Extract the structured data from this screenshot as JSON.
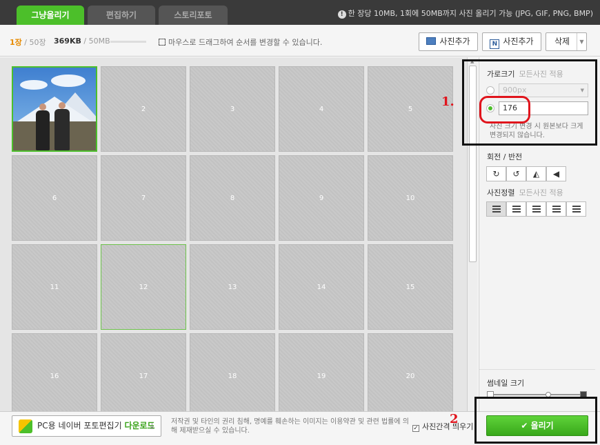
{
  "tabs": [
    {
      "label": "그냥올리기"
    },
    {
      "label": "편집하기"
    },
    {
      "label": "스토리포토"
    }
  ],
  "notice": "한 장당 10MB, 1회에 50MB까지 사진 올리기 가능 (JPG, GIF, PNG, BMP)",
  "toolbar": {
    "count_current": "1장",
    "count_total": "/ 50장",
    "size_used": "369KB",
    "size_limit": "/ 50MB",
    "drag_hint": "마우스로 드래그하여 순서를 변경할 수 있습니다.",
    "add_pc_label": "사진추가",
    "add_naver_label": "사진추가",
    "delete_label": "삭제"
  },
  "grid": {
    "cells": [
      "",
      "2",
      "3",
      "4",
      "5",
      "6",
      "7",
      "8",
      "9",
      "10",
      "11",
      "12",
      "13",
      "14",
      "15",
      "16",
      "17",
      "18",
      "19",
      "20"
    ]
  },
  "panel": {
    "width_label": "가로크기",
    "width_all": "모든사진 적용",
    "preset_value": "900px",
    "custom_value": "176",
    "note": "사진 크기 변경 시 원본보다 크게 변경되지 않습니다.",
    "rotate_label": "회전 / 반전",
    "align_label": "사진정렬",
    "align_all": "모든사진 적용",
    "thumb_label": "썸네일 크기"
  },
  "bottom": {
    "download_prefix": "PC용 네이버 포토편집기",
    "download_suffix": "다운로드",
    "copyright": "저작권 및 타인의 권리 침해, 명예를 훼손하는 이미지는 이용약관 및 관련 법률에 의해 제재받으실 수 있습니다.",
    "spacing_label": "사진간격 띄우기",
    "upload_label": "올리기"
  },
  "annotations": {
    "num1": "1.",
    "num2": "2"
  },
  "colors": {
    "accent_green": "#4cbf2a",
    "annotation_red": "#e0141c"
  }
}
